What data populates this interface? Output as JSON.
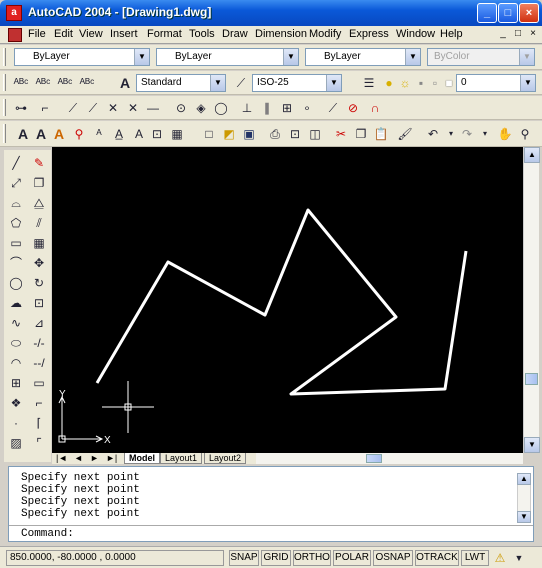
{
  "window": {
    "title": "AutoCAD 2004 - [Drawing1.dwg]",
    "app_icon": "autocad-icon",
    "controls": [
      "_",
      "□",
      "×"
    ]
  },
  "menubar": {
    "items": [
      "File",
      "Edit",
      "View",
      "Insert",
      "Format",
      "Tools",
      "Draw",
      "Dimension",
      "Modify",
      "Express",
      "Window",
      "Help"
    ],
    "mdi_controls": [
      "_",
      "□",
      "×"
    ]
  },
  "properties_toolbar": {
    "layer_value": "ByLayer",
    "linetype_value": "ByLayer",
    "lineweight_value": "ByLayer",
    "plotstyle_value": "ByColor"
  },
  "styles_toolbar": {
    "text_style_value": "Standard",
    "dim_style_value": "ISO-25",
    "layer_state_value": "0"
  },
  "canvas": {
    "background": "#000000",
    "polyline_color": "#ffffff",
    "ucs_x_label": "X",
    "ucs_y_label": "Y"
  },
  "layout_tabs": {
    "tabs": [
      "Model",
      "Layout1",
      "Layout2"
    ],
    "active": "Model"
  },
  "command": {
    "history": [
      "Specify next point",
      "Specify next point",
      "Specify next point",
      "Specify next point"
    ],
    "prompt": "Command:"
  },
  "status": {
    "coordinates": "850.0000, -80.0000 , 0.0000",
    "toggles": [
      "SNAP",
      "GRID",
      "ORTHO",
      "POLAR",
      "OSNAP",
      "OTRACK",
      "LWT"
    ]
  }
}
